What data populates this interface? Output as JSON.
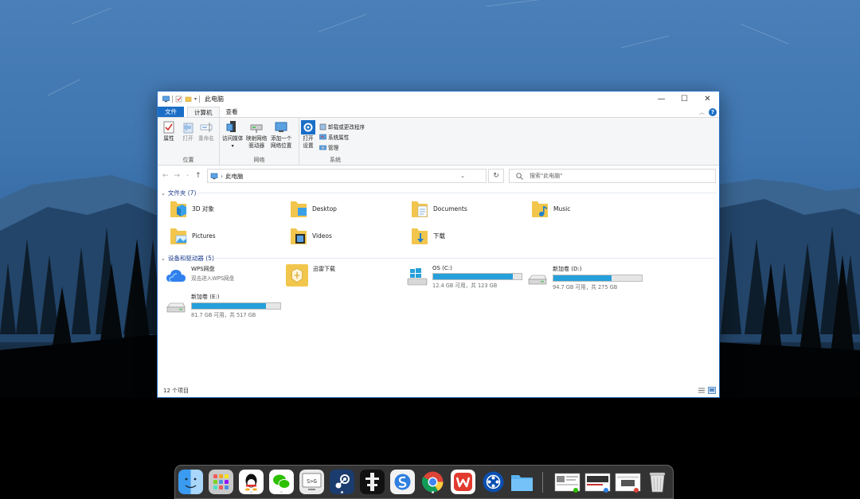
{
  "window": {
    "title": "此电脑",
    "controls": {
      "minimize": "—",
      "maximize": "☐",
      "close": "✕"
    }
  },
  "tabs": [
    {
      "label": "文件"
    },
    {
      "label": "计算机"
    },
    {
      "label": "查看"
    }
  ],
  "ribbon": {
    "location_group": {
      "label": "位置",
      "properties": "属性",
      "open": "打开",
      "rename": "重命名"
    },
    "network_group": {
      "label": "网络",
      "access_media": "访问媒体",
      "map_drive_line1": "映射网络",
      "map_drive_line2": "驱动器",
      "add_location_line1": "添加一个",
      "add_location_line2": "网络位置"
    },
    "system_group": {
      "label": "系统",
      "open_settings_line1": "打开",
      "open_settings_line2": "设置",
      "uninstall": "卸载或更改程序",
      "system_properties": "系统属性",
      "manage": "管理"
    }
  },
  "address": {
    "path": "此电脑",
    "search_placeholder": "搜索\"此电脑\""
  },
  "folders_group": {
    "label": "文件夹 (7)"
  },
  "folders": [
    {
      "name": "3D 对象",
      "icon": "3d-objects-icon"
    },
    {
      "name": "Desktop",
      "icon": "desktop-folder-icon"
    },
    {
      "name": "Documents",
      "icon": "documents-folder-icon"
    },
    {
      "name": "Music",
      "icon": "music-folder-icon"
    },
    {
      "name": "Pictures",
      "icon": "pictures-folder-icon"
    },
    {
      "name": "Videos",
      "icon": "videos-folder-icon"
    },
    {
      "name": "下载",
      "icon": "downloads-folder-icon"
    }
  ],
  "drives_group": {
    "label": "设备和驱动器 (5)"
  },
  "drives": [
    {
      "name": "WPS网盘",
      "sub": "双击进入WPS网盘",
      "icon": "wps-cloud-icon"
    },
    {
      "name": "迅雷下载",
      "icon": "xunlei-icon"
    },
    {
      "name": "OS (C:)",
      "sub": "12.4 GB 可用，共 123 GB",
      "used_fraction": 0.9,
      "icon": "windows-drive-icon"
    },
    {
      "name": "新加卷 (D:)",
      "sub": "94.7 GB 可用，共 275 GB",
      "used_fraction": 0.66,
      "icon": "hard-drive-icon"
    },
    {
      "name": "新加卷 (E:)",
      "sub": "81.7 GB 可用，共 517 GB",
      "used_fraction": 0.84,
      "icon": "hard-drive-icon"
    }
  ],
  "status": {
    "count": "12 个项目"
  },
  "colors": {
    "accent": "#1a6ec7",
    "drive_bar": "#26a0da",
    "group_header": "#1e3d8f"
  },
  "dock": [
    {
      "name": "finder-icon"
    },
    {
      "name": "launchpad-icon"
    },
    {
      "name": "qq-icon"
    },
    {
      "name": "wechat-icon"
    },
    {
      "name": "terminal-icon"
    },
    {
      "name": "steam-icon"
    },
    {
      "name": "app-icon"
    },
    {
      "name": "sogou-icon"
    },
    {
      "name": "chrome-icon"
    },
    {
      "name": "wps-icon"
    },
    {
      "name": "video-player-icon"
    },
    {
      "name": "folder-icon"
    },
    {
      "name": "recent-window-1"
    },
    {
      "name": "recent-window-2"
    },
    {
      "name": "recent-window-3"
    },
    {
      "name": "trash-icon"
    }
  ],
  "dock_glyphs": {
    "terminal": "S>G"
  }
}
